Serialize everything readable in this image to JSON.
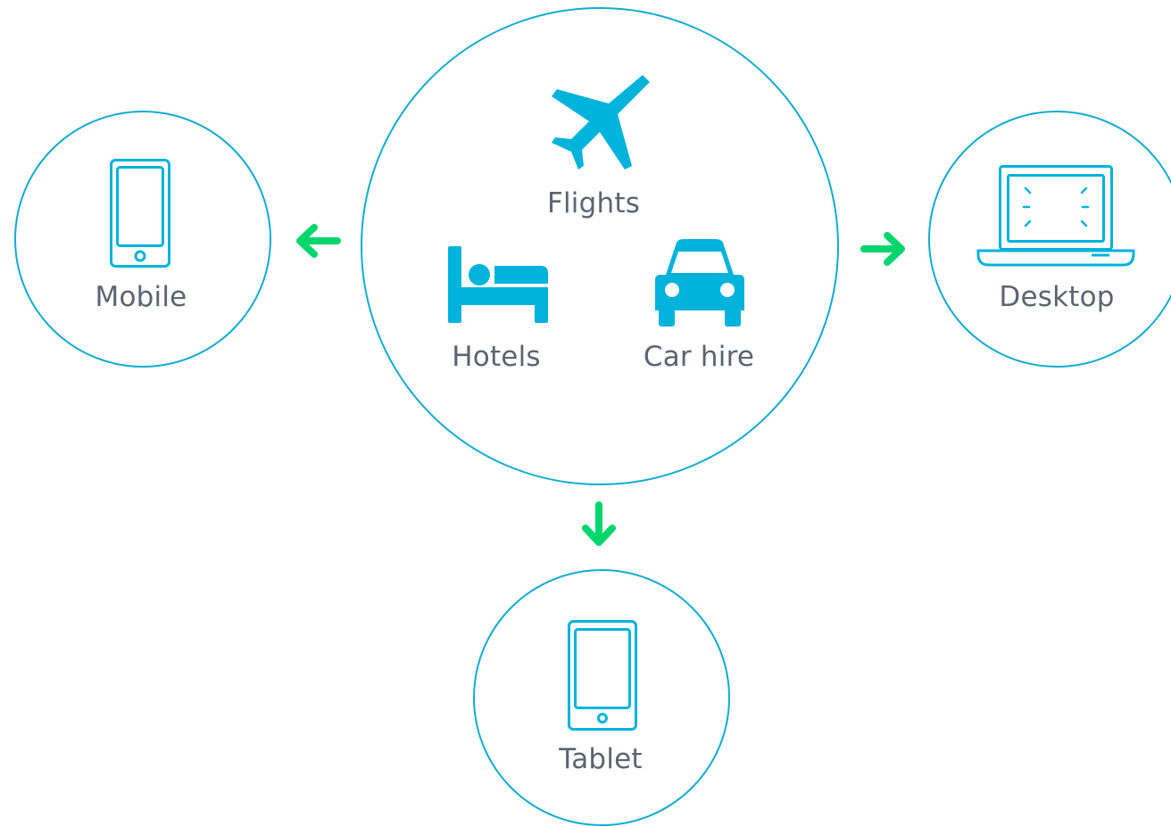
{
  "hub": {
    "flights_label": "Flights",
    "hotels_label": "Hotels",
    "car_hire_label": "Car hire"
  },
  "devices": {
    "mobile_label": "Mobile",
    "desktop_label": "Desktop",
    "tablet_label": "Tablet"
  },
  "colors": {
    "outline": "#10acd0",
    "icon_fill": "#00b3db",
    "arrow": "#00d56e",
    "label_text": "#5b6472"
  },
  "icons": {
    "flights": "airplane-icon",
    "hotels": "bed-icon",
    "car_hire": "car-icon",
    "mobile": "phone-icon",
    "desktop": "laptop-icon",
    "tablet": "tablet-icon"
  }
}
